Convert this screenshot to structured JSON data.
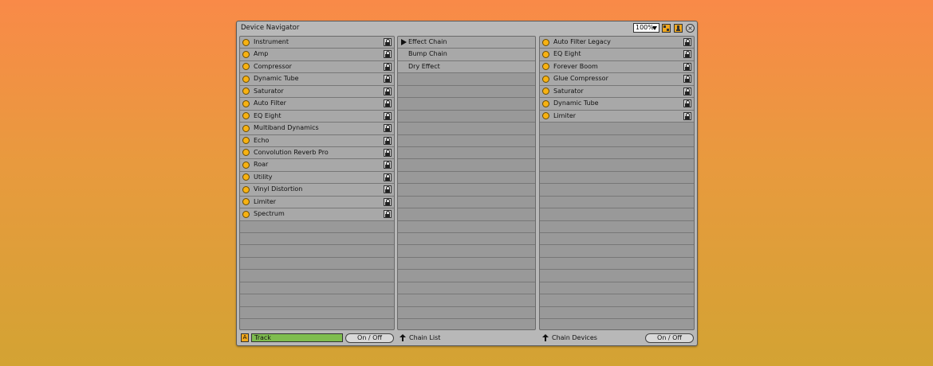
{
  "window": {
    "title": "Device Navigator",
    "zoom": "100%",
    "close_glyph": "×"
  },
  "devices": [
    "Instrument",
    "Amp",
    "Compressor",
    "Dynamic Tube",
    "Saturator",
    "Auto Filter",
    "EQ Eight",
    "Multiband Dynamics",
    "Echo",
    "Convolution Reverb Pro",
    "Roar",
    "Utility",
    "Vinyl Distortion",
    "Limiter",
    "Spectrum"
  ],
  "chains": [
    "Effect Chain",
    "Bump Chain",
    "Dry Effect"
  ],
  "chain_devices": [
    "Auto Filter Legacy",
    "EQ Eight",
    "Forever Boom",
    "Glue Compressor",
    "Saturator",
    "Dynamic Tube",
    "Limiter"
  ],
  "footer": {
    "a_label": "A",
    "track_label": "Track",
    "onoff_left": "On / Off",
    "chain_list": "Chain List",
    "chain_devices": "Chain Devices",
    "onoff_right": "On / Off"
  },
  "colors": {
    "device_dot": "#f7b212",
    "track_field": "#7fbd4f",
    "toolbar_button": "#f0a81e"
  },
  "icons": {
    "device_state": "circle-dot-icon",
    "lock": "lock-icon",
    "selected_chain": "play-triangle-icon",
    "nav": "up-arrow-icon"
  }
}
